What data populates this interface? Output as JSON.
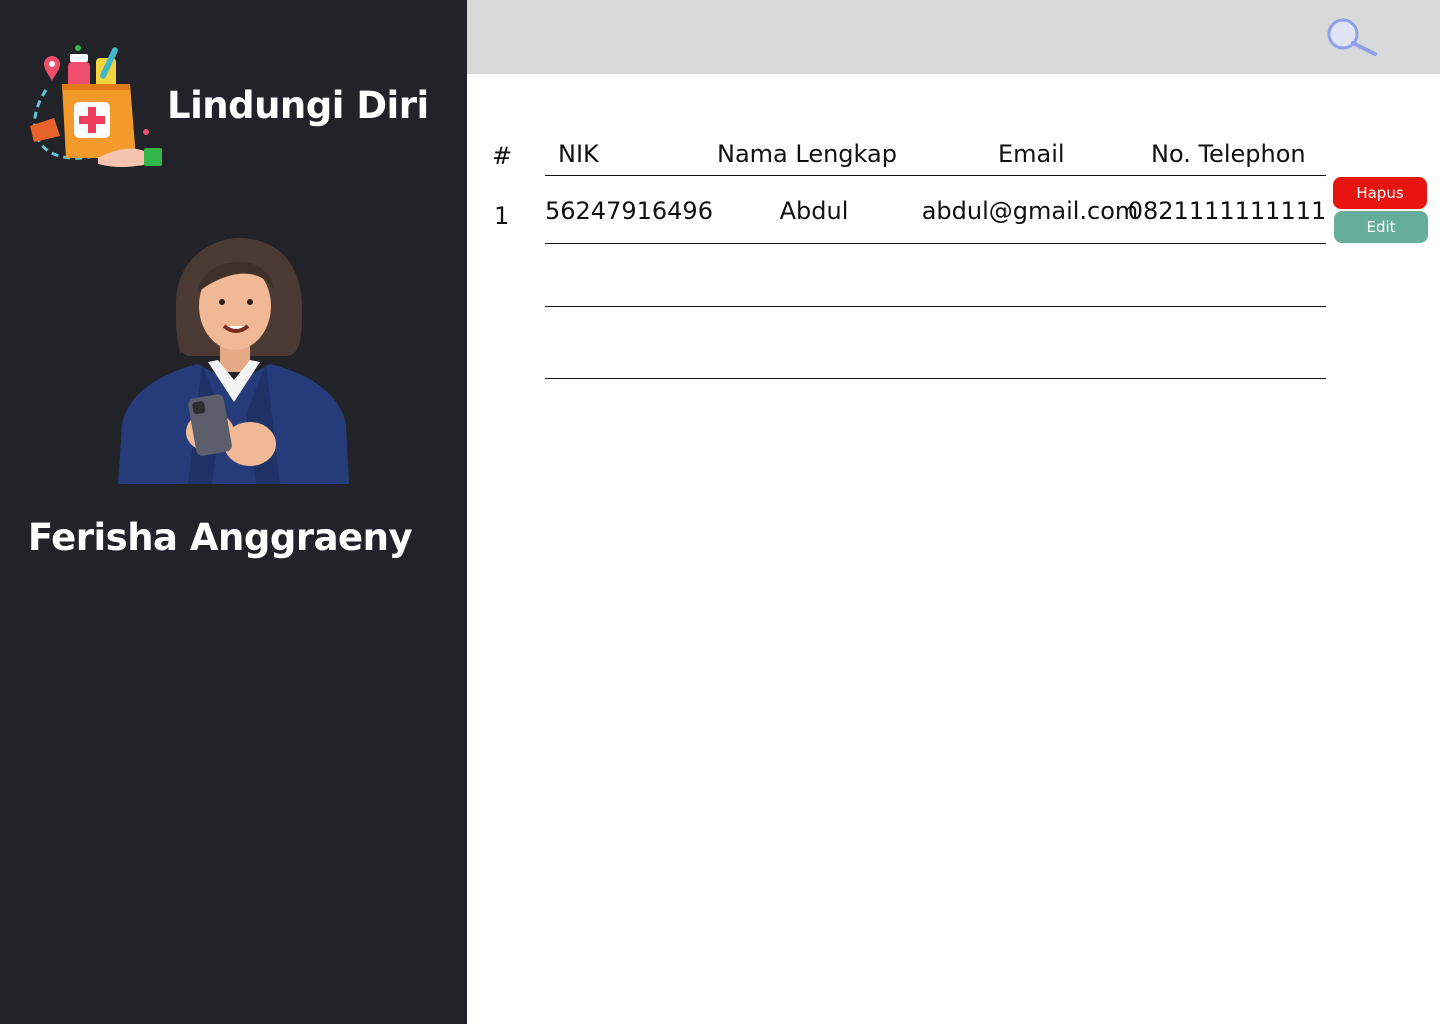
{
  "app": {
    "title": "Lindungi Diri"
  },
  "user": {
    "name": "Ferisha Anggraeny"
  },
  "colors": {
    "sidebar_bg": "#212328",
    "topbar_bg": "#d9d9d9",
    "delete": "#e8140f",
    "edit": "#67ad9b",
    "search_icon": "#8fa0e8"
  },
  "table": {
    "headers": {
      "index": "#",
      "nik": "NIK",
      "name": "Nama Lengkap",
      "email": "Email",
      "phone": "No. Telephon"
    },
    "rows": [
      {
        "index": "1",
        "nik": "56247916496",
        "name": "Abdul",
        "email": "abdul@gmail.com",
        "phone": "0821111111111"
      }
    ]
  },
  "actions": {
    "delete_label": "Hapus",
    "edit_label": "Edit"
  },
  "icons": {
    "search": "search-icon",
    "logo": "medicine-bag-icon",
    "avatar": "user-avatar"
  }
}
